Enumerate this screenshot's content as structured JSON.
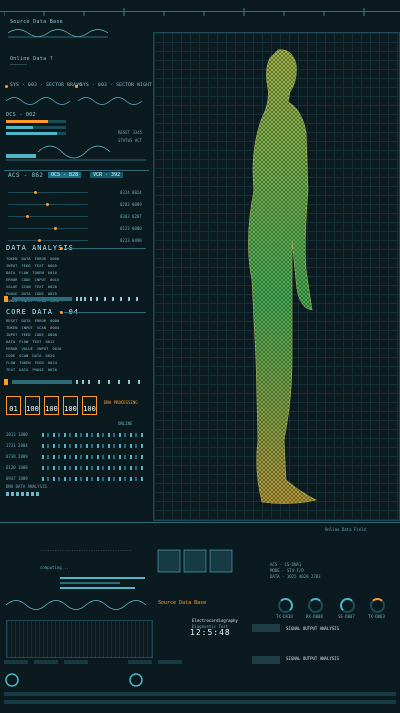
{
  "top": {
    "source_data": "Source Data Base",
    "online_data": "Online Data ?"
  },
  "sectors": {
    "left": "SYS - 003 - SECTOR BRAVO",
    "right": "SYS - 003 - SECTOR NIGHT"
  },
  "dcs": {
    "label": "DCS - 002",
    "reset": "RESET",
    "rows": [
      "RESET 3345",
      "STATUS ACT"
    ]
  },
  "acs": {
    "label": "ACS - 862",
    "tag1": "OCS - 828",
    "tag2": "VCR - 392"
  },
  "sliders": [
    {
      "value": "0324 0024",
      "level": 0.35
    },
    {
      "value": "0203 0009",
      "level": 0.5
    },
    {
      "value": "0303 0207",
      "level": 0.25
    },
    {
      "value": "0123 0000",
      "level": 0.6
    },
    {
      "value": "0223 0490",
      "level": 0.4
    }
  ],
  "data_analysis": {
    "title": "DATA ANALYSIS",
    "rows": [
      [
        "TOKEN",
        "DATA",
        "ERROR",
        "0000"
      ],
      [
        "INPUT",
        "FEED",
        "TEXT",
        "0005"
      ],
      [
        "DATA",
        "FLOW",
        "TOKEN",
        "0010"
      ],
      [
        "ERROR",
        "CODE",
        "INPUT",
        "0015"
      ],
      [
        "VALUE",
        "SCAN",
        "TEXT",
        "0020"
      ],
      [
        "PHASE",
        "DATA",
        "CODE",
        "0025"
      ],
      [
        "TOKEN",
        "INPUT",
        "FLOW",
        "0030"
      ]
    ]
  },
  "core_data": {
    "title": "CORE DATA - 04",
    "rows": [
      [
        "RESET",
        "DATA",
        "ERROR",
        "0000"
      ],
      [
        "TOKEN",
        "INPUT",
        "SCAN",
        "0004"
      ],
      [
        "INPUT",
        "FEED",
        "CODE",
        "0008"
      ],
      [
        "DATA",
        "FLOW",
        "TEXT",
        "0012"
      ],
      [
        "ERROR",
        "VALUE",
        "INPUT",
        "0016"
      ],
      [
        "CODE",
        "SCAN",
        "DATA",
        "0020"
      ],
      [
        "FLOW",
        "TOKEN",
        "FEED",
        "0024"
      ],
      [
        "TEXT",
        "DATA",
        "PHASE",
        "0028"
      ]
    ]
  },
  "docs": [
    "01",
    "100",
    "100",
    "100",
    "100"
  ],
  "processing": {
    "label": "DNA PROCESSING",
    "status": "ONLINE"
  },
  "dna_rows": [
    "2013 1000",
    "1721 2004",
    "0738 2009",
    "6120 1008",
    "0947 1009"
  ],
  "dna_analysis": "DNA DATA ANALYSIS",
  "computing": "computing...",
  "source_base": "Source Data Base",
  "right_info": {
    "title": "Online Data Field",
    "acs": "ACS - CS-DNA1",
    "mode": "MODE - ST4-F/O",
    "data": "DATA - 1025 4020 2783"
  },
  "gauges": [
    "TX-DA3D",
    "RX-D008",
    "SE-D007",
    "TX-D003"
  ],
  "electro": {
    "title": "Electrocardiography",
    "sub": "Diagnostic Test",
    "time": "12:5:48"
  },
  "signals": [
    {
      "title": "SIGNAL OUTPUT ANALYSIS"
    },
    {
      "title": "SIGNAL OUTPUT ANALYSIS"
    }
  ],
  "colors": {
    "accent": "#ff9a2a",
    "cyan": "#4fb6c8",
    "body_top": "#c8d64a",
    "body_bottom": "#3fd06a"
  }
}
